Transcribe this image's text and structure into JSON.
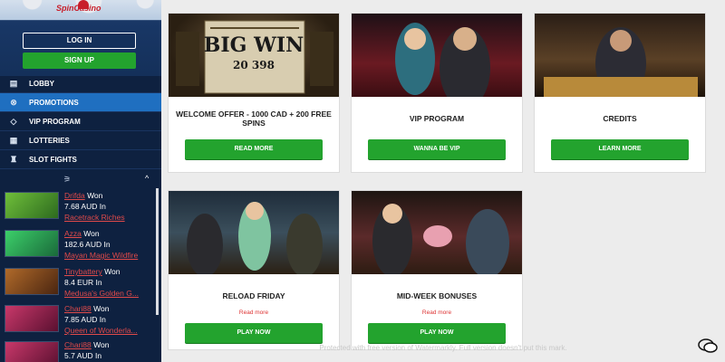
{
  "sidebar": {
    "logo_text": "SpinCasino",
    "login_label": "LOG IN",
    "signup_label": "SIGN UP",
    "menu": [
      {
        "label": "LOBBY",
        "icon": "lobby-icon",
        "glyph": "▤",
        "active": false
      },
      {
        "label": "PROMOTIONS",
        "icon": "promotions-icon",
        "glyph": "⊗",
        "active": true
      },
      {
        "label": "VIP PROGRAM",
        "icon": "diamond-icon",
        "glyph": "◇",
        "active": false
      },
      {
        "label": "LOTTERIES",
        "icon": "lotteries-icon",
        "glyph": "▦",
        "active": false
      },
      {
        "label": "SLOT FIGHTS",
        "icon": "trophy-icon",
        "glyph": "♜",
        "active": false
      }
    ],
    "winners_icon": "ticker-icon",
    "winners": [
      {
        "name": "Drifda",
        "won": "Won",
        "amount": "7.68 AUD In",
        "game": "Racetrack Riches",
        "thumb_color": "#3f7f2b"
      },
      {
        "name": "Azza",
        "won": "Won",
        "amount": "182.6 AUD In",
        "game": "Mayan Magic Wildfire",
        "thumb_color": "#2a8a4a"
      },
      {
        "name": "Tinybattery",
        "won": "Won",
        "amount": "8.4 EUR In",
        "game": "Medusa's Golden G...",
        "thumb_color": "#6a3b1f"
      },
      {
        "name": "Chari88",
        "won": "Won",
        "amount": "7.85 AUD In",
        "game": "Queen of Wonderla...",
        "thumb_color": "#7a1f3a"
      },
      {
        "name": "Chari88",
        "won": "Won",
        "amount": "5.7 AUD In",
        "game": "",
        "thumb_color": "#7a1f3a"
      }
    ]
  },
  "promos": [
    {
      "title": "WELCOME OFFER - 1000 CAD + 200 FREE SPINS",
      "button": "READ MORE",
      "link": "",
      "image_text": "BIG WIN",
      "image_sub": "20 398"
    },
    {
      "title": "VIP PROGRAM",
      "button": "WANNA BE VIP",
      "link": ""
    },
    {
      "title": "CREDITS",
      "button": "LEARN MORE",
      "link": ""
    },
    {
      "title": "RELOAD FRIDAY",
      "button": "PLAY NOW",
      "link": "Read more"
    },
    {
      "title": "MID-WEEK BONUSES",
      "button": "PLAY NOW",
      "link": "Read more"
    }
  ],
  "footer_note": "Protected with free version of Watermarkly. Full version doesn't put this mark.",
  "colors": {
    "sidebar": "#0e2140",
    "accent_green": "#23a32e",
    "active_blue": "#1f6fc0",
    "link_red": "#d33"
  },
  "chat_icon": "chat-icon"
}
